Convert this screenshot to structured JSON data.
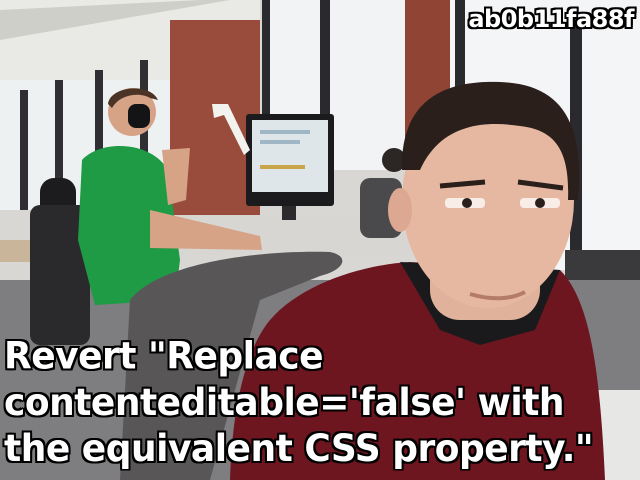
{
  "meme": {
    "commit_hash": "ab0b11fa88f",
    "caption_lines": [
      "Revert \"Replace",
      "contenteditable='false' with",
      "the equivalent CSS property.\""
    ]
  },
  "colors": {
    "shirt": "#6e1620",
    "green_shirt": "#1f9a45",
    "brick": "#9b4a3a",
    "window": "#e8ecee"
  }
}
